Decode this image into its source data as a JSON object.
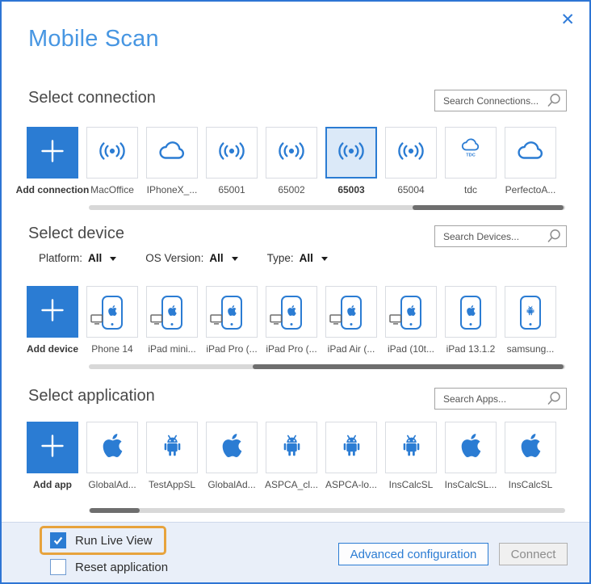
{
  "dialog": {
    "title": "Mobile Scan",
    "close_glyph": "✕"
  },
  "colors": {
    "accent_blue": "#2b7cd3",
    "title_blue": "#4796e2",
    "selected_tile_bg": "#dbe9f8",
    "dialog_border": "#2e75d4",
    "highlight_orange": "#e7a33d",
    "footer_bg": "#e9eff9",
    "scrollbar_track": "#d8d8d8",
    "scrollbar_thumb": "#6e6e6e"
  },
  "sections": {
    "connection": {
      "title": "Select connection",
      "search_placeholder": "Search Connections...",
      "add_label": "Add connection",
      "tiles": [
        {
          "label": "MacOffice",
          "icon": "wifi"
        },
        {
          "label": "IPhoneX_...",
          "icon": "cloud"
        },
        {
          "label": "65001",
          "icon": "wifi"
        },
        {
          "label": "65002",
          "icon": "wifi"
        },
        {
          "label": "65003",
          "icon": "wifi",
          "selected": true
        },
        {
          "label": "65004",
          "icon": "wifi"
        },
        {
          "label": "tdc",
          "icon": "cloud-tdc"
        },
        {
          "label": "PerfectoA...",
          "icon": "cloud"
        }
      ]
    },
    "device": {
      "title": "Select device",
      "search_placeholder": "Search Devices...",
      "add_label": "Add device",
      "filters": [
        {
          "id": "platform",
          "label": "Platform:",
          "value": "All"
        },
        {
          "id": "os-version",
          "label": "OS Version:",
          "value": "All"
        },
        {
          "id": "type",
          "label": "Type:",
          "value": "All"
        }
      ],
      "tiles": [
        {
          "label": "Phone 14",
          "icon": "iphone",
          "monitor": true
        },
        {
          "label": "iPad mini...",
          "icon": "iphone",
          "monitor": true
        },
        {
          "label": "iPad Pro (...",
          "icon": "iphone",
          "monitor": true
        },
        {
          "label": "iPad Pro (...",
          "icon": "iphone",
          "monitor": true
        },
        {
          "label": "iPad Air (...",
          "icon": "iphone",
          "monitor": true
        },
        {
          "label": "iPad (10t...",
          "icon": "iphone",
          "monitor": true
        },
        {
          "label": "iPad 13.1.2",
          "icon": "iphone",
          "monitor": false
        },
        {
          "label": "samsung...",
          "icon": "android-phone",
          "monitor": false
        }
      ]
    },
    "application": {
      "title": "Select application",
      "search_placeholder": "Search Apps...",
      "add_label": "Add app",
      "tiles": [
        {
          "label": "GlobalAd...",
          "icon": "apple"
        },
        {
          "label": "TestAppSL",
          "icon": "android"
        },
        {
          "label": "GlobalAd...",
          "icon": "apple"
        },
        {
          "label": "ASPCA_cl...",
          "icon": "android"
        },
        {
          "label": "ASPCA-lo...",
          "icon": "android"
        },
        {
          "label": "InsCalcSL",
          "icon": "android"
        },
        {
          "label": "InsCalcSL...",
          "icon": "apple"
        },
        {
          "label": "InsCalcSL",
          "icon": "apple"
        }
      ]
    }
  },
  "footer": {
    "run_live_view": {
      "label": "Run Live View",
      "checked": true,
      "highlighted": true
    },
    "reset_application": {
      "label": "Reset application",
      "checked": false
    },
    "advanced_button": "Advanced configuration",
    "connect_button": "Connect"
  }
}
